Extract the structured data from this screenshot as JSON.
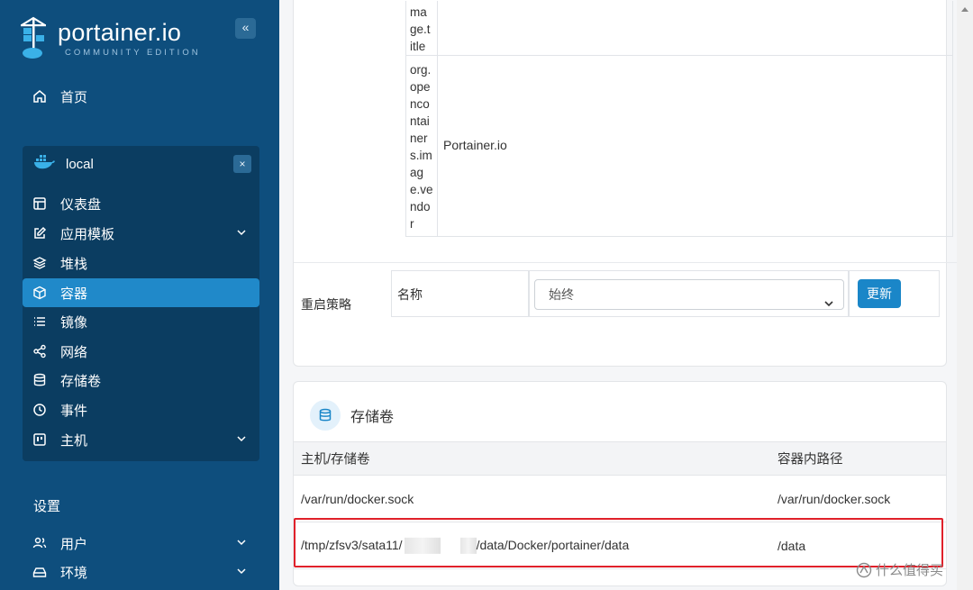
{
  "app": {
    "logo_title": "portainer.io",
    "logo_subtitle": "COMMUNITY EDITION",
    "collapse_label": "«"
  },
  "sidebar": {
    "home": "首页",
    "environment": {
      "name": "local",
      "close_label": "×"
    },
    "env_items": [
      {
        "label": "仪表盘",
        "icon": "dashboard-icon"
      },
      {
        "label": "应用模板",
        "icon": "edit-icon",
        "expandable": true
      },
      {
        "label": "堆栈",
        "icon": "layers-icon"
      },
      {
        "label": "容器",
        "icon": "box-icon",
        "active": true
      },
      {
        "label": "镜像",
        "icon": "list-icon"
      },
      {
        "label": "网络",
        "icon": "share-icon"
      },
      {
        "label": "存储卷",
        "icon": "database-icon"
      },
      {
        "label": "事件",
        "icon": "clock-icon"
      },
      {
        "label": "主机",
        "icon": "host-icon",
        "expandable": true
      }
    ],
    "settings_title": "设置",
    "settings_items": [
      {
        "label": "用户",
        "icon": "users-icon",
        "expandable": true
      },
      {
        "label": "环境",
        "icon": "hdd-icon",
        "expandable": true
      }
    ]
  },
  "labels": [
    {
      "key": "ma\nge.t\nitle",
      "value": ""
    },
    {
      "key": "org.opencontainers.image.vendor",
      "value": "Portainer.io"
    }
  ],
  "restart_policy": {
    "label": "重启策略",
    "name_label": "名称",
    "selected": "始终",
    "update_button": "更新"
  },
  "volumes": {
    "title": "存储卷",
    "columns": [
      "主机/存储卷",
      "容器内路径"
    ],
    "rows": [
      {
        "host_prefix": "/var/run/docker.sock",
        "host_suffix": "",
        "container": "/var/run/docker.sock",
        "redacted": false
      },
      {
        "host_prefix": "/tmp/zfsv3/sata11/",
        "host_suffix": "/data/Docker/portainer/data",
        "container": "/data",
        "redacted": true
      }
    ]
  },
  "watermark": "什么值得买",
  "colors": {
    "sidebar": "#0e4e7d",
    "accent": "#2089c9",
    "highlight": "#e0202a"
  }
}
